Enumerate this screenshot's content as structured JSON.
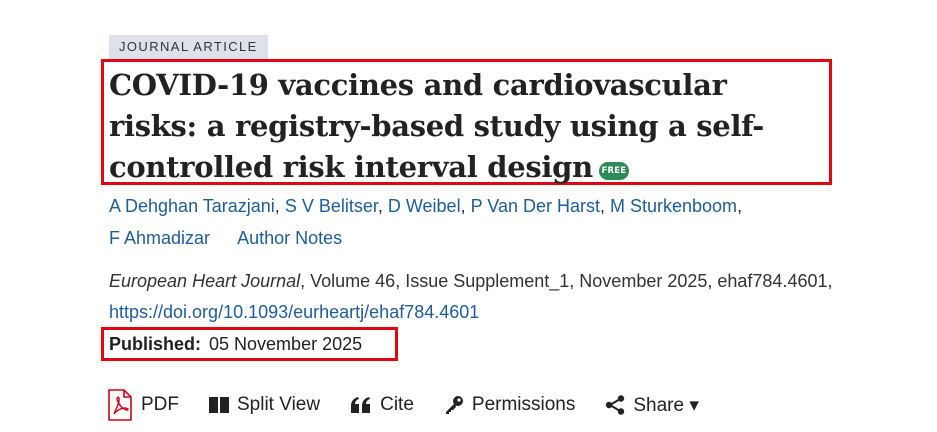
{
  "article": {
    "type_badge": "JOURNAL ARTICLE",
    "title": "COVID-19 vaccines and cardiovascular risks: a registry-based study using a self-controlled risk interval design",
    "free_badge": "FREE",
    "authors": [
      "A Dehghan Tarazjani",
      "S V Belitser",
      "D Weibel",
      "P Van Der Harst",
      "M Sturkenboom",
      "F Ahmadizar"
    ],
    "author_notes": "Author Notes",
    "journal": "European Heart Journal",
    "citation_rest": ", Volume 46, Issue Supplement_1, November 2025, ehaf784.4601,",
    "doi": "https://doi.org/10.1093/eurheartj/ehaf784.4601",
    "published_label": "Published:",
    "published_date": "05 November 2025"
  },
  "toolbar": {
    "pdf": "PDF",
    "split_view": "Split View",
    "cite": "Cite",
    "permissions": "Permissions",
    "share": "Share ▾"
  },
  "colors": {
    "highlight_border": "#e30613",
    "link": "#1f5c9a",
    "free_badge": "#2e8b57",
    "badge_bg": "#dde1ea",
    "pdf_icon": "#d0021b"
  },
  "icons": [
    "pdf-icon",
    "split-view-icon",
    "cite-quote-icon",
    "key-icon",
    "share-icon"
  ]
}
